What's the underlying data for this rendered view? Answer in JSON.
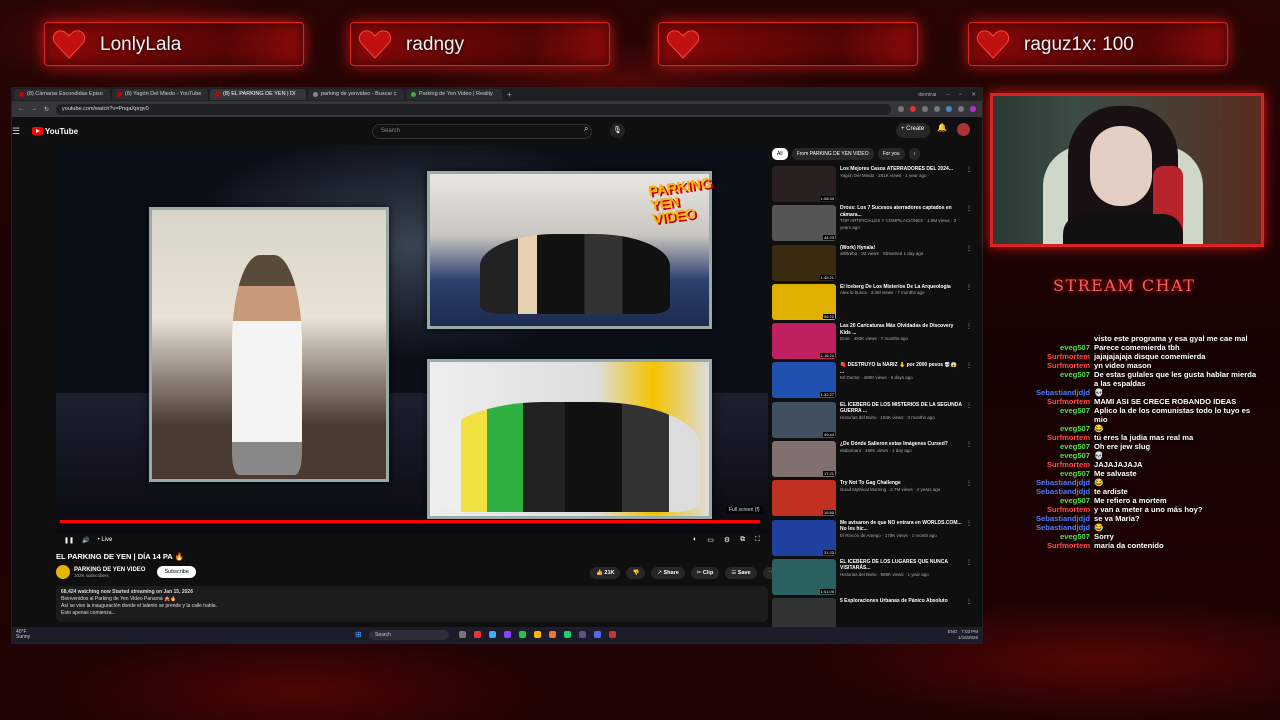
{
  "overlay": {
    "pills": [
      {
        "name": "LonlyLala"
      },
      {
        "name": "radngy"
      },
      {
        "name": ""
      },
      {
        "name": "raguz1x: 100"
      }
    ],
    "chat_title": "STREAM CHAT",
    "chat_messages": [
      {
        "user": "",
        "color": "#ffffff",
        "text": "visto este programa y esa gyal me cae mal"
      },
      {
        "user": "eveg507",
        "color": "#4ce04c",
        "text": "Parece comemierda tbh"
      },
      {
        "user": "Surfmortem",
        "color": "#ff4a4a",
        "text": "jajajajajaja disque comemierda"
      },
      {
        "user": "Surfmortem",
        "color": "#ff4a4a",
        "text": "yn video mason"
      },
      {
        "user": "eveg507",
        "color": "#4ce04c",
        "text": "De estas gulales que les gusta hablar mierda a las espaldas"
      },
      {
        "user": "Sebastiandjdjd",
        "color": "#4a7cff",
        "text": "💀"
      },
      {
        "user": "Surfmortem",
        "color": "#ff4a4a",
        "text": "MAMI ASI SE CRECE ROBANDO IDEAS"
      },
      {
        "user": "eveg507",
        "color": "#4ce04c",
        "text": "Aplico la de los comunistas todo lo tuyo es mio"
      },
      {
        "user": "eveg507",
        "color": "#4ce04c",
        "text": "😂"
      },
      {
        "user": "Surfmortem",
        "color": "#ff4a4a",
        "text": "tú eres la judia mas real ma"
      },
      {
        "user": "eveg507",
        "color": "#4ce04c",
        "text": "Oh ere jew slug"
      },
      {
        "user": "eveg507",
        "color": "#4ce04c",
        "text": "💀"
      },
      {
        "user": "Surfmortem",
        "color": "#ff4a4a",
        "text": "JAJAJAJAJA"
      },
      {
        "user": "eveg507",
        "color": "#4ce04c",
        "text": "Me salvaste"
      },
      {
        "user": "Sebastiandjdjd",
        "color": "#4a7cff",
        "text": "😂"
      },
      {
        "user": "Sebastiandjdjd",
        "color": "#4a7cff",
        "text": "te ardiste"
      },
      {
        "user": "eveg507",
        "color": "#4ce04c",
        "text": "Me refiero a mortem"
      },
      {
        "user": "Surfmortem",
        "color": "#ff4a4a",
        "text": "y van a meter a uno más hoy?"
      },
      {
        "user": "Sebastiandjdjd",
        "color": "#4a7cff",
        "text": "se va María?"
      },
      {
        "user": "Sebastiandjdjd",
        "color": "#4a7cff",
        "text": "😂"
      },
      {
        "user": "eveg507",
        "color": "#4ce04c",
        "text": "Sorry"
      },
      {
        "user": "Surfmortem",
        "color": "#ff4a4a",
        "text": "maría da contenido"
      }
    ]
  },
  "browser": {
    "tabs": [
      {
        "label": "(8) Cámaras Escondidas Episo"
      },
      {
        "label": "(8) Yagón Del Miedo - YouTube"
      },
      {
        "label": "(8) EL PARKING DE YEN | Dí"
      },
      {
        "label": "parking de yenvideo - Buscar c"
      },
      {
        "label": "Parking de Yen Video | Reality"
      }
    ],
    "profile": "demirai",
    "url": "youtube.com/watch?v=PnqaXprgv0",
    "logo": "YouTube",
    "search_placeholder": "Search",
    "create_label": "+ Create",
    "video": {
      "brand": "PARKING YEN VIDEO",
      "live_label": "• Live",
      "fullscreen_tip": "Full screen (f)",
      "title": "EL PARKING DE YEN | DÍA 14 PA 🔥",
      "channel": "PARKING DE YEN VIDEO",
      "subscribers": "102K subscribers",
      "subscribe_label": "Subscribe",
      "likes": "21K",
      "share_label": "Share",
      "clip_label": "Clip",
      "save_label": "Save",
      "desc_line1": "68,424 watching now  Started streaming on Jan 15, 2026",
      "desc_line2": "Bienvenidos al Parking de Yen Video Panamá 🎪🔥",
      "desc_line3": "Así se vive la inauguración donde el talento se prende y la calle habla.",
      "desc_line4": "Esto apenas comienza..."
    },
    "chips": [
      "All",
      "From PARKING DE YEN VIDEO",
      "For you"
    ],
    "recommendations": [
      {
        "title": "Los Mejores Casos ATERRADORES DEL 2024...",
        "meta": "Yagón Del Miedo · 281K views · 1 year ago",
        "color": "#2a2020",
        "dur": "1:08:33"
      },
      {
        "title": "Dross: Los 7 Sucesos aterradores captados en cámara...",
        "meta": "TOP ARTIFICIALES Y COMPILACIONES · 1.9M views · 3 years ago",
        "color": "#555",
        "dur": "44:23"
      },
      {
        "title": "(Work) Hynala!",
        "meta": "xBBreba · 32 views · Streamed 1 day ago",
        "color": "#3a2a10",
        "dur": "1:45:21"
      },
      {
        "title": "El Iceberg De Los Misterios De La Arqueología",
        "meta": "Alex lo busca · 3.3M views · 7 months ago",
        "color": "#e0b000",
        "dur": "56:22"
      },
      {
        "title": "Las 20 Caricaturas Más Olvidadas de Discovery Kids ...",
        "meta": "Dore · 493K views · 7 months ago",
        "color": "#c02060",
        "dur": "1:16:24"
      },
      {
        "title": "🍓 DESTRUYÓ la NARIZ 👃 por 2000 pesos 💀😱 ...",
        "meta": "Mr Doctor · 480K views · 6 days ago",
        "color": "#2050b0",
        "dur": "1:32:27"
      },
      {
        "title": "EL ICEBERG DE LOS MISTERIOS DE LA SEGUNDA GUERRA ...",
        "meta": "Historias del Buho · 184K views · 3 months ago",
        "color": "#405060",
        "dur": "49:44"
      },
      {
        "title": "¿De Dónde Salieron estas Imágenes Cursed?",
        "meta": "elabomant · 496K views · 1 day ago",
        "color": "#807070",
        "dur": "17:21"
      },
      {
        "title": "Try Not To Gag Challenge",
        "meta": "Good Mythical Morning · 2.7M views · 4 years ago",
        "color": "#c03020",
        "dur": "16:50"
      },
      {
        "title": "Me avisaron de que NO entrara en WORLDS.COM... No les hic...",
        "meta": "El Rincón de Amego · 178K views · 1 month ago",
        "color": "#2040a0",
        "dur": "31:23"
      },
      {
        "title": "EL ICEBERG DE LOS LUGARES QUE NUNCA VISITARÁS...",
        "meta": "Historias del Buho · 998K views · 1 year ago",
        "color": "#2a6060",
        "dur": "1:01:06"
      },
      {
        "title": "5 Exploraciones Urbanas de Pánico Absoluto",
        "meta": "",
        "color": "#333",
        "dur": ""
      }
    ],
    "taskbar": {
      "weather_temp": "40°F",
      "weather_desc": "Sunny",
      "search": "Search",
      "lang": "ENG",
      "time": "7:03 PM",
      "date": "1/16/2026"
    }
  }
}
